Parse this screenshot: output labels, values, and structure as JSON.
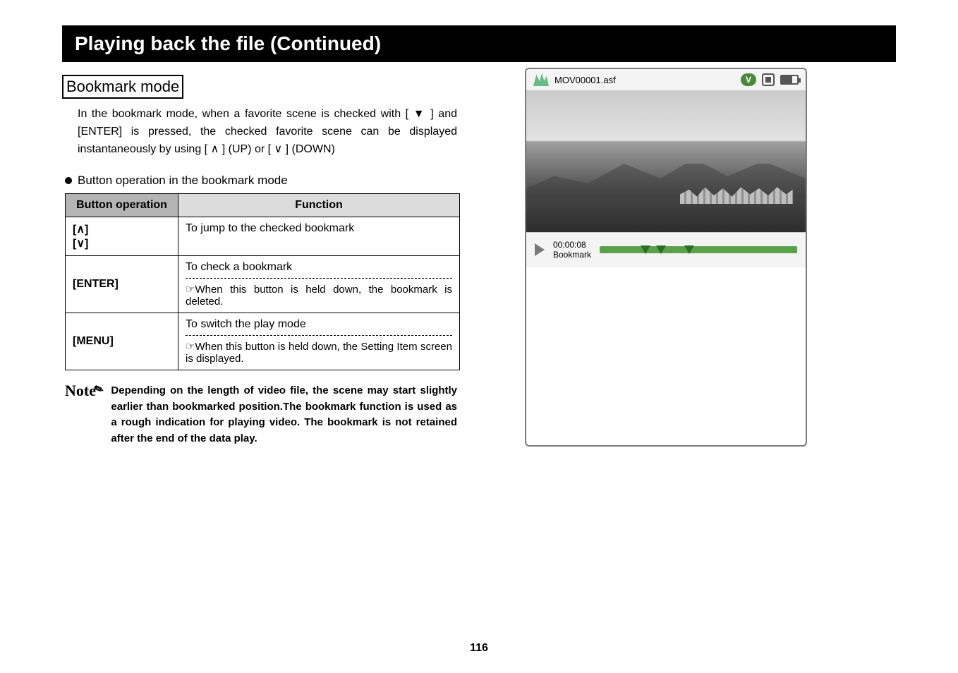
{
  "title": "Playing back the file (Continued)",
  "section": "Bookmark mode",
  "intro": "In the bookmark mode, when a favorite scene is checked with [ ▼ ] and [ENTER] is pressed, the checked favorite scene can be displayed instantaneously by using [ ∧ ] (UP) or [ ∨ ] (DOWN)",
  "bullet": "Button operation in the bookmark mode",
  "table": {
    "head_button": "Button operation",
    "head_function": "Function",
    "rows": [
      {
        "button": "[∧]\n[∨]",
        "fn_main": "To jump to the checked bookmark",
        "fn_sub": ""
      },
      {
        "button": "[ENTER]",
        "fn_main": "To check a bookmark",
        "fn_sub": "☞When this button is held down, the bookmark is deleted."
      },
      {
        "button": "[MENU]",
        "fn_main": "To switch the play mode",
        "fn_sub": "☞When this button is held down, the Setting Item screen is displayed."
      }
    ]
  },
  "note_label": "Note",
  "note_text": "Depending on the length of video file, the scene may start slightly earlier than bookmarked position.The bookmark function is used as a rough indication for playing video. The bookmark is not retained after the end of the data play.",
  "device": {
    "filename": "MOV00001.asf",
    "badge": "V",
    "time": "00:00:08",
    "mode": "Bookmark"
  },
  "page_number": "116"
}
